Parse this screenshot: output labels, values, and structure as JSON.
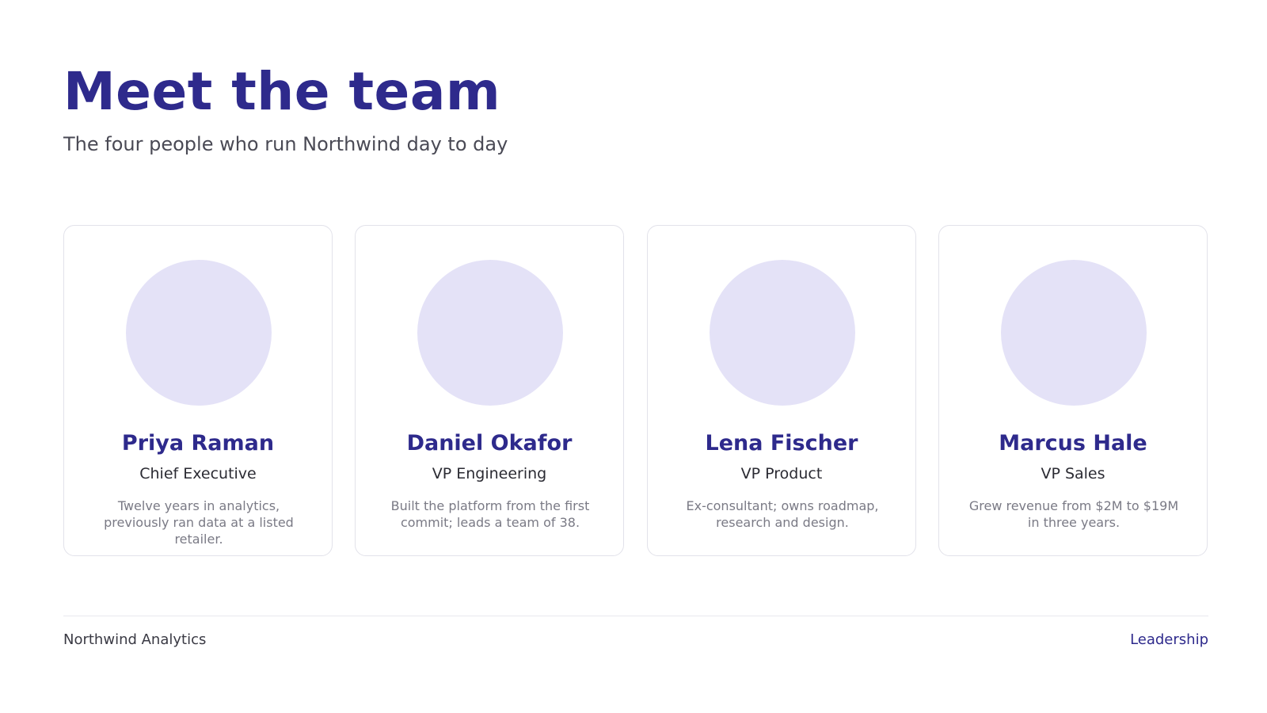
{
  "header": {
    "title": "Meet the team",
    "subtitle": "The four people who run Northwind day to day"
  },
  "team": [
    {
      "name": "Priya Raman",
      "role": "Chief Executive",
      "bio": "Twelve years in analytics, previously ran data at a listed retailer."
    },
    {
      "name": "Daniel Okafor",
      "role": "VP Engineering",
      "bio": "Built the platform from the first commit; leads a team of 38."
    },
    {
      "name": "Lena Fischer",
      "role": "VP Product",
      "bio": "Ex-consultant; owns roadmap, research and design."
    },
    {
      "name": "Marcus Hale",
      "role": "VP Sales",
      "bio": "Grew revenue from $2M to $19M in three years."
    }
  ],
  "footer": {
    "company": "Northwind Analytics",
    "section": "Leadership"
  },
  "colors": {
    "accent": "#2e2a8c",
    "avatar_placeholder": "#e4e2f7",
    "card_border": "#e2e2ea",
    "body_text": "#4a4a55",
    "muted_text": "#7a7a85"
  }
}
